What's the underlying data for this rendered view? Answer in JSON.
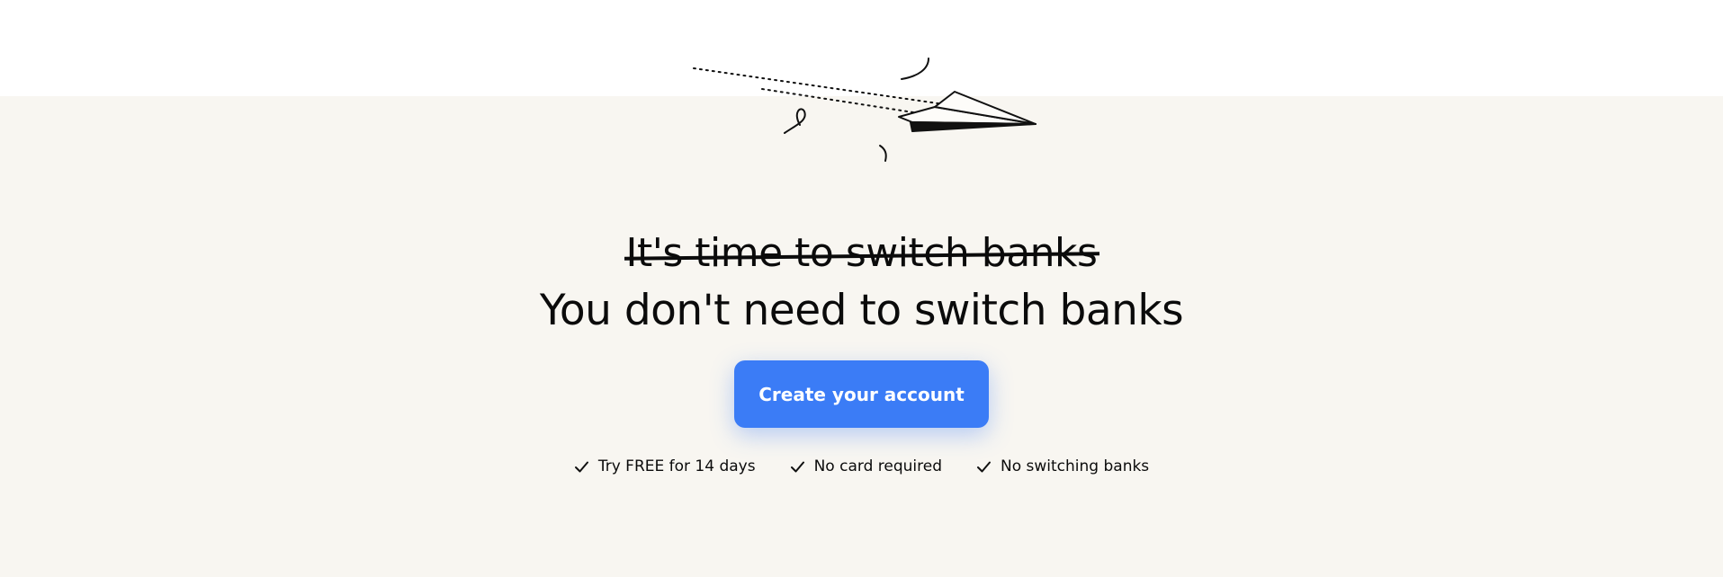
{
  "hero": {
    "headline_struck": "It's time to switch banks",
    "headline": "You don't need to switch banks",
    "cta_label": "Create your account",
    "features": [
      {
        "icon": "check-icon",
        "label": "Try FREE for 14 days"
      },
      {
        "icon": "check-icon",
        "label": "No card required"
      },
      {
        "icon": "check-icon",
        "label": "No switching banks"
      }
    ]
  },
  "colors": {
    "accent": "#3b7cf6",
    "hero_background": "#f8f6f1",
    "text": "#0b0b0b"
  }
}
